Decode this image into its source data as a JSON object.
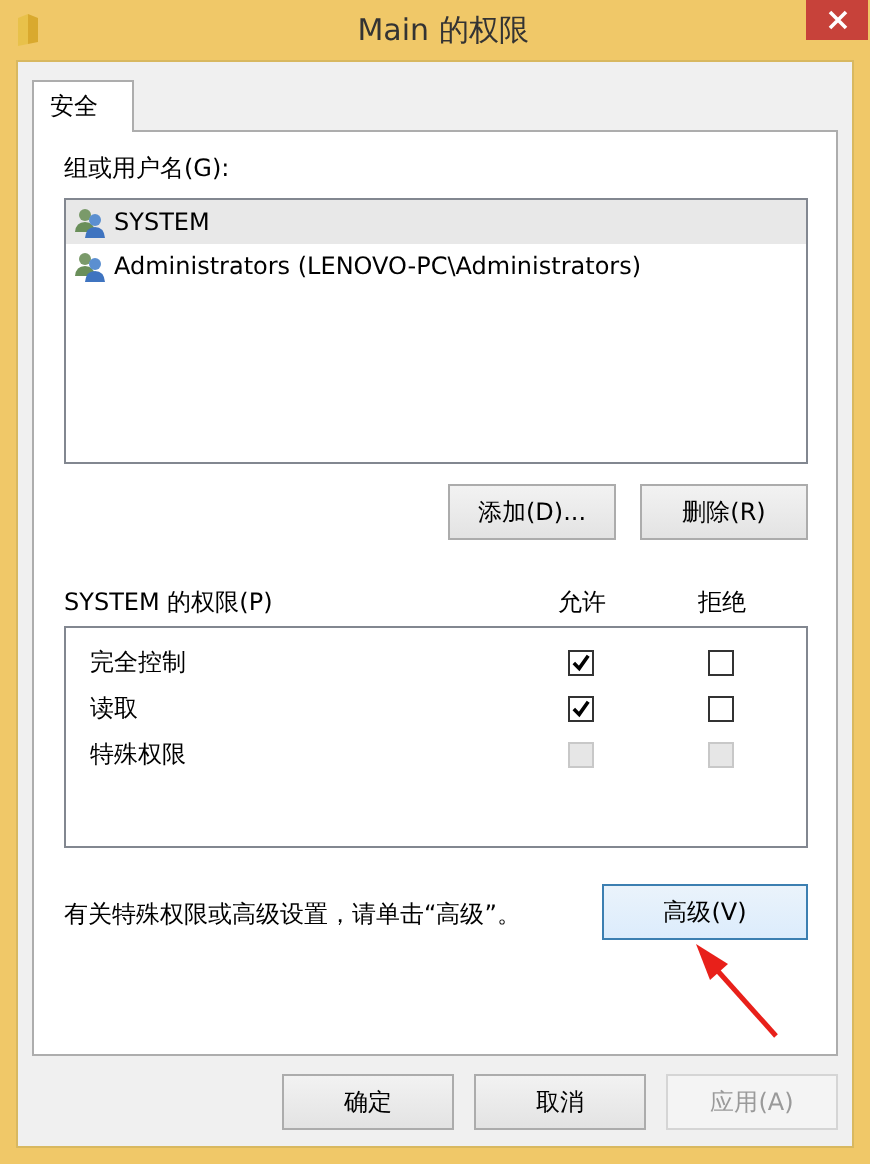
{
  "window": {
    "title": "Main 的权限"
  },
  "tabs": [
    {
      "label": "安全",
      "selected": true
    }
  ],
  "users": {
    "label": "组或用户名(G):",
    "items": [
      {
        "name": "SYSTEM",
        "selected": true
      },
      {
        "name": "Administrators (LENOVO-PC\\Administrators)",
        "selected": false
      }
    ],
    "buttons": [
      "添加(D)...",
      "删除(R)"
    ]
  },
  "permissions": {
    "label": "SYSTEM 的权限(P)",
    "columns": [
      "允许",
      "拒绝"
    ],
    "rows": [
      {
        "name": "完全控制",
        "allow": {
          "checked": true,
          "disabled": false
        },
        "deny": {
          "checked": false,
          "disabled": false
        }
      },
      {
        "name": "读取",
        "allow": {
          "checked": true,
          "disabled": false
        },
        "deny": {
          "checked": false,
          "disabled": false
        }
      },
      {
        "name": "特殊权限",
        "allow": {
          "checked": false,
          "disabled": true
        },
        "deny": {
          "checked": false,
          "disabled": true
        }
      }
    ]
  },
  "advanced": {
    "hint": "有关特殊权限或高级设置，请单击“高级”。",
    "button": "高级(V)"
  },
  "footer": [
    {
      "label": "确定",
      "disabled": false
    },
    {
      "label": "取消",
      "disabled": false
    },
    {
      "label": "应用(A)",
      "disabled": true
    }
  ]
}
